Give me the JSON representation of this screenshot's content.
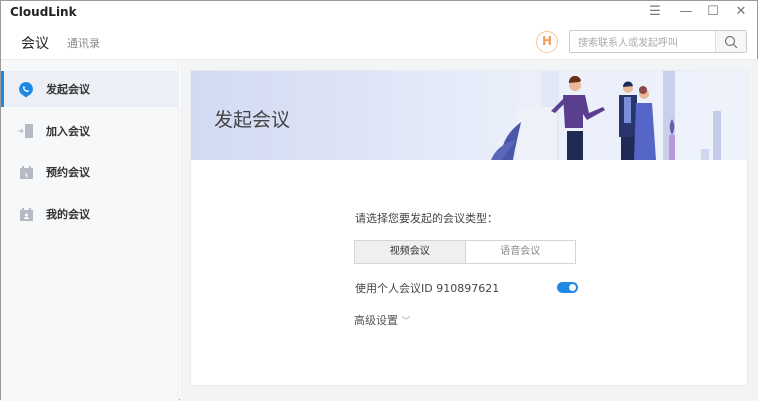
{
  "app": {
    "title": "CloudLink"
  },
  "header": {
    "tabs": [
      {
        "label": "会议"
      },
      {
        "label": "通讯录"
      }
    ],
    "avatar_letter": "H",
    "search_placeholder": "搜索联系人或发起呼叫"
  },
  "sidebar": {
    "items": [
      {
        "label": "发起会议",
        "icon": "start-meeting-icon"
      },
      {
        "label": "加入会议",
        "icon": "join-door-icon"
      },
      {
        "label": "预约会议",
        "icon": "calendar-clock-icon"
      },
      {
        "label": "我的会议",
        "icon": "calendar-person-icon"
      }
    ]
  },
  "main": {
    "banner_title": "发起会议",
    "prompt": "请选择您要发起的会议类型：",
    "types": [
      {
        "label": "视频会议"
      },
      {
        "label": "语音会议"
      }
    ],
    "personal_id_label": "使用个人会议ID 910897621",
    "personal_id_enabled": true,
    "advanced_label": "高级设置"
  },
  "colors": {
    "accent": "#1e88e5"
  }
}
